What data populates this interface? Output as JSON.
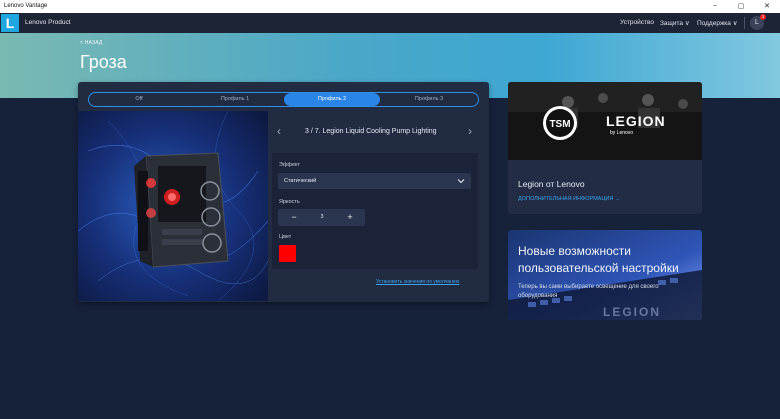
{
  "os_window": {
    "title": "Lenovo Vantage",
    "minimize": "−",
    "maximize": "▢",
    "close": "✕"
  },
  "header": {
    "logo_letter": "L",
    "app_name": "Lenovo Product",
    "nav": [
      {
        "label": "Устройство"
      },
      {
        "label": "Защита ∨"
      },
      {
        "label": "Поддержка ∨"
      }
    ],
    "avatar_letter": "L",
    "badge_count": "1"
  },
  "hero": {
    "back_label": "< НАЗАД",
    "title": "Гроза",
    "colors": {
      "start": "#7ab9b2",
      "mid": "#3ea7d3",
      "end": "#82c8e0"
    }
  },
  "lighting": {
    "profiles": [
      {
        "label": "Off",
        "active": false
      },
      {
        "label": "Профиль 1",
        "active": false
      },
      {
        "label": "Профиль 2",
        "active": true
      },
      {
        "label": "Профиль 3",
        "active": false
      }
    ],
    "zone_title": "3 / 7. Legion Liquid Cooling Pump Lighting",
    "effect_label": "Эффект",
    "effect_value": "Статический",
    "brightness_label": "Яркость",
    "brightness_value": "3",
    "decrement": "−",
    "increment": "+",
    "color_label": "Цвет",
    "color_value": "#ff0000",
    "reset_label": "Установить значения по умолчанию"
  },
  "cards": {
    "legion": {
      "title": "Legion от Lenovo",
      "link": "ДОПОЛНИТЕЛЬНАЯ ИНФОРМАЦИЯ  →",
      "logo_text": "LEGION",
      "logo_sub": "by Lenovo",
      "team_logo": "TSM"
    },
    "personalize": {
      "title": "Новые возможности пользовательской настройки",
      "subtitle": "Теперь вы сами выбираете освещение для своего оборудования",
      "keyboard_text": "LEGION"
    }
  },
  "accent_color": "#2b85e6"
}
